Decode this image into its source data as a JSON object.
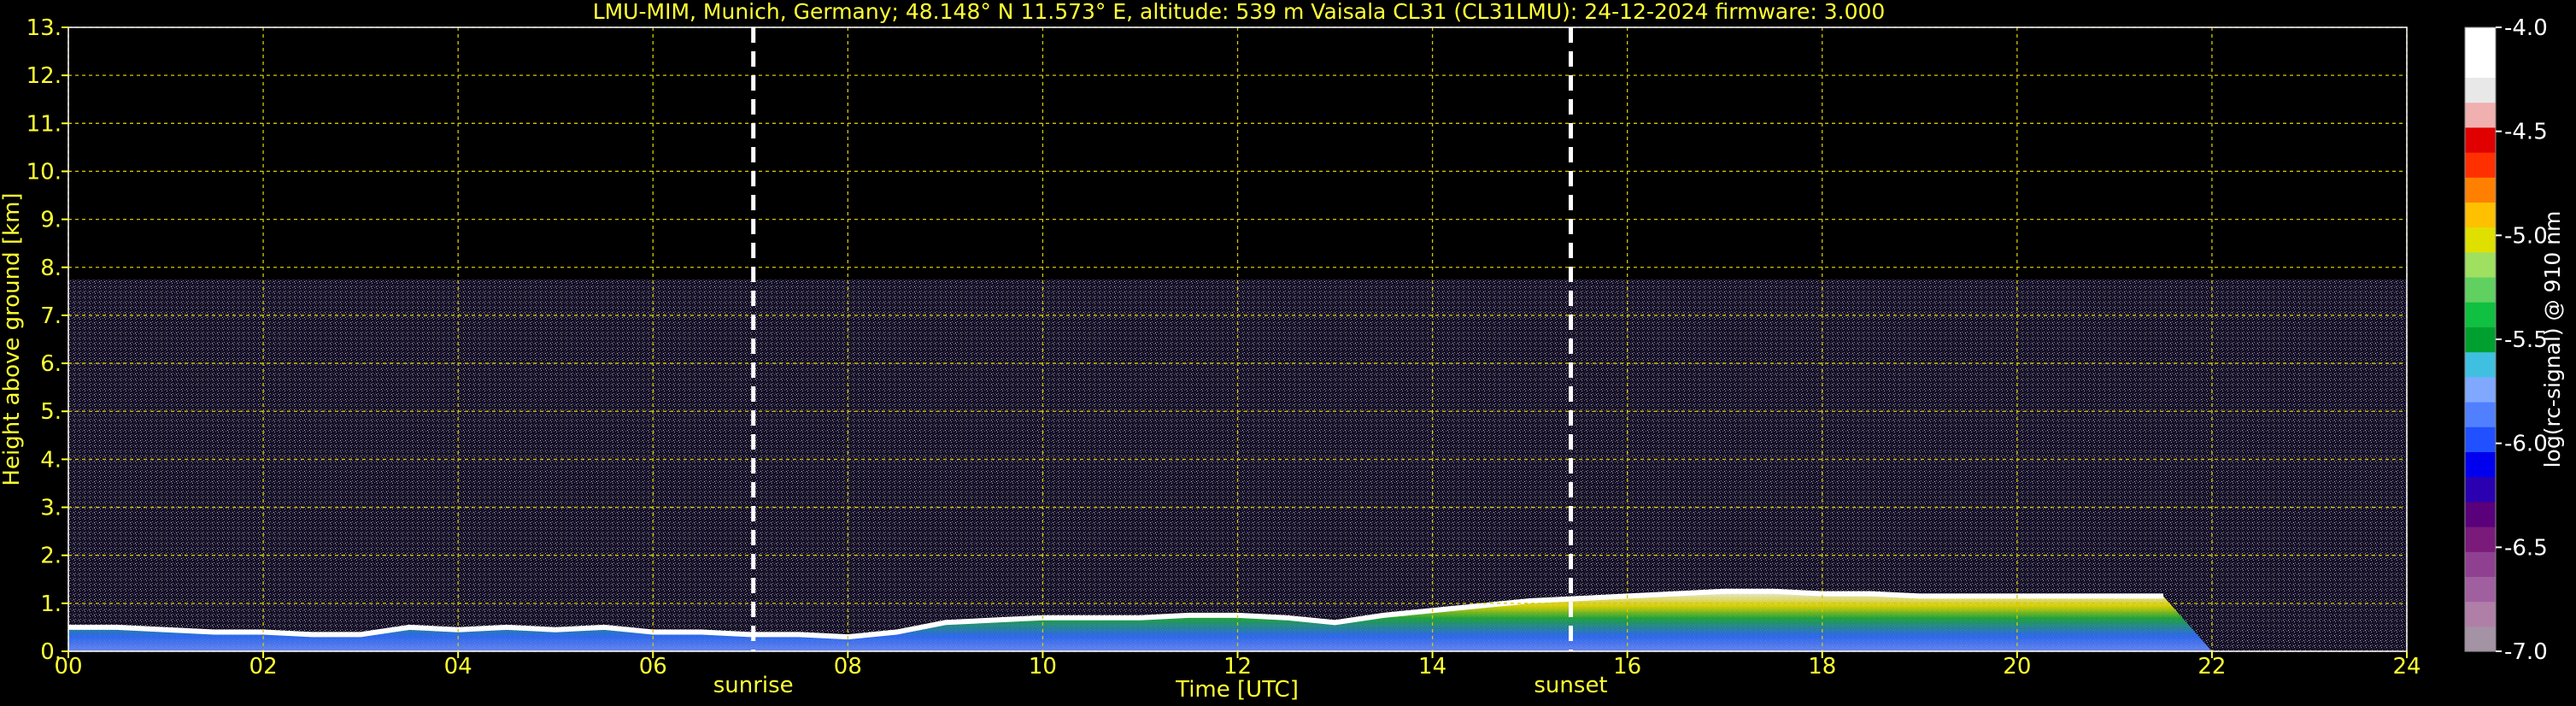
{
  "chart_data": {
    "type": "heatmap",
    "title": "LMU-MIM, Munich, Germany; 48.148° N 11.573° E, altitude: 539 m    Vaisala CL31 (CL31LMU): 24-12-2024    firmware: 3.000",
    "xlabel": "Time [UTC]",
    "ylabel": "Height above ground [km]",
    "xlim": [
      0,
      24
    ],
    "ylim": [
      0,
      13
    ],
    "x_ticks": [
      "00",
      "02",
      "04",
      "06",
      "08",
      "10",
      "12",
      "14",
      "16",
      "18",
      "20",
      "22",
      "24"
    ],
    "y_ticks": [
      "0.",
      "1.",
      "2.",
      "3.",
      "4.",
      "5.",
      "6.",
      "7.",
      "8.",
      "9.",
      "10.",
      "11.",
      "12.",
      "13."
    ],
    "grid": true,
    "grid_color": "#d4c800",
    "text_color": "#ffff33",
    "background": "#000000",
    "signal_top_km": 7.75,
    "markers": [
      {
        "label": "sunrise",
        "x": 7.03
      },
      {
        "label": "sunset",
        "x": 15.42
      }
    ],
    "boundary_layer": {
      "x": [
        0,
        0.5,
        1,
        1.5,
        2,
        2.5,
        3,
        3.5,
        4,
        4.5,
        5,
        5.5,
        6,
        6.5,
        7,
        7.5,
        8,
        8.5,
        9,
        9.5,
        10,
        10.5,
        11,
        11.5,
        12,
        12.5,
        13,
        13.5,
        14,
        14.5,
        15,
        15.5,
        16,
        16.5,
        17,
        17.5,
        18,
        18.5,
        19,
        19.5,
        20,
        20.5,
        21,
        21.5,
        22,
        22.5,
        23,
        23.5,
        24
      ],
      "top": [
        0.5,
        0.5,
        0.45,
        0.4,
        0.4,
        0.35,
        0.35,
        0.5,
        0.45,
        0.5,
        0.45,
        0.5,
        0.4,
        0.4,
        0.35,
        0.35,
        0.3,
        0.4,
        0.6,
        0.65,
        0.7,
        0.7,
        0.7,
        0.75,
        0.75,
        0.7,
        0.6,
        0.75,
        0.85,
        0.95,
        1.05,
        1.1,
        1.15,
        1.2,
        1.25,
        1.25,
        1.2,
        1.2,
        1.15,
        1.15,
        1.15,
        1.15,
        1.15,
        1.15,
        0,
        0,
        0,
        0,
        0
      ]
    },
    "colorbar": {
      "label": "log(rc-signal) @ 910 nm",
      "min": -7.0,
      "max": -4.0,
      "ticks": [
        "-4.0",
        "-4.5",
        "-5.0",
        "-5.5",
        "-6.0",
        "-6.5",
        "-7.0"
      ],
      "colors": [
        "#a493a4",
        "#b07fa8",
        "#a060a0",
        "#904090",
        "#7a1a7a",
        "#5a007a",
        "#2a00b0",
        "#0000ee",
        "#2050ff",
        "#5080ff",
        "#80a8ff",
        "#40c0e0",
        "#00a030",
        "#10c040",
        "#60d060",
        "#a0e060",
        "#e0e000",
        "#ffc000",
        "#ff8000",
        "#ff3000",
        "#e00000",
        "#f0b0b0",
        "#e8e8e8",
        "#ffffff",
        "#ffffff"
      ]
    }
  }
}
